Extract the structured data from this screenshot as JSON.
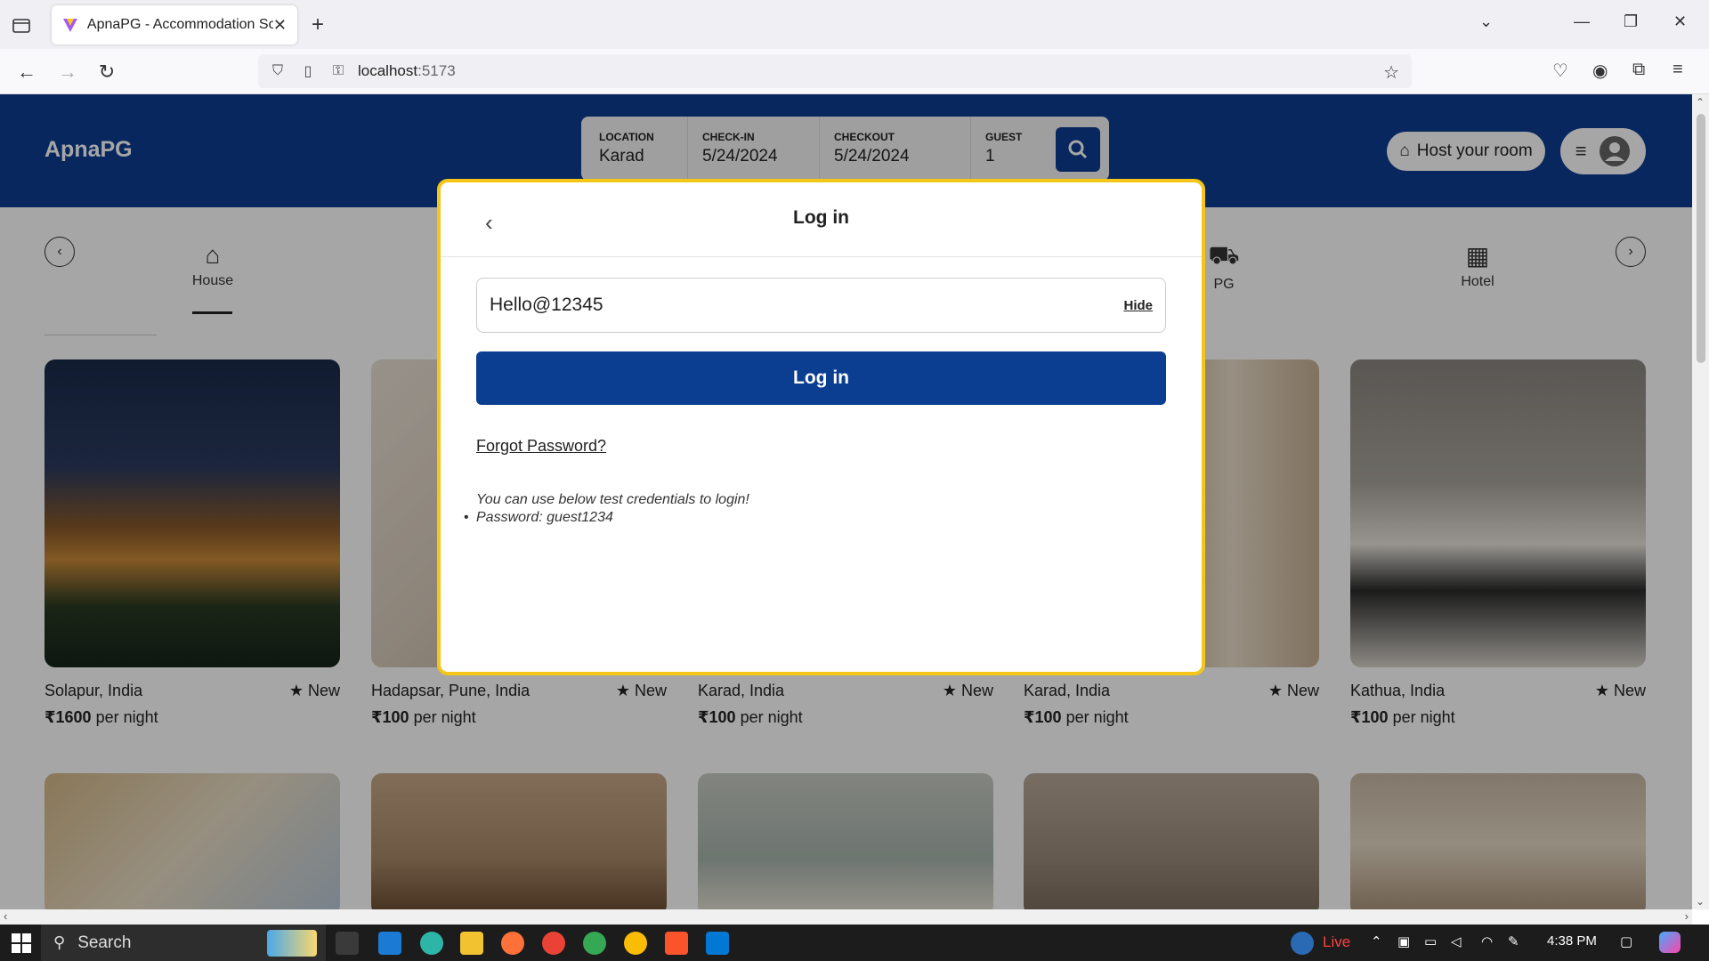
{
  "browser": {
    "tab_title": "ApnaPG - Accommodation Solu",
    "url_host": "localhost",
    "url_port": ":5173"
  },
  "header": {
    "logo": "ApnaPG",
    "search": {
      "location_label": "LOCATION",
      "location_value": "Karad",
      "checkin_label": "CHECK-IN",
      "checkin_value": "5/24/2024",
      "checkout_label": "CHECKOUT",
      "checkout_value": "5/24/2024",
      "guest_label": "GUEST",
      "guest_value": "1"
    },
    "host_label": "Host your room"
  },
  "categories": [
    {
      "label": "House",
      "icon": "house-icon"
    },
    {
      "label": "PG",
      "icon": "caravan-icon"
    },
    {
      "label": "Hotel",
      "icon": "hotel-icon"
    }
  ],
  "listings": [
    {
      "title": "Solapur, India",
      "rating": "New",
      "price": "₹1600",
      "unit": " per night"
    },
    {
      "title": "Hadapsar, Pune, India",
      "rating": "New",
      "price": "₹100",
      "unit": " per night"
    },
    {
      "title": "Karad, India",
      "rating": "New",
      "price": "₹100",
      "unit": " per night"
    },
    {
      "title": "Karad, India",
      "rating": "New",
      "price": "₹100",
      "unit": " per night"
    },
    {
      "title": "Kathua, India",
      "rating": "New",
      "price": "₹100",
      "unit": " per night"
    }
  ],
  "modal": {
    "title": "Log in",
    "password_value": "Hello@12345",
    "hide_label": "Hide",
    "login_label": "Log in",
    "forgot_label": "Forgot Password?",
    "hint": "You can use below test credentials to login!",
    "hint_password": "Password: guest1234"
  },
  "taskbar": {
    "search_label": "Search",
    "live_label": "Live",
    "time": "4:38 PM"
  },
  "colors": {
    "brand": "#0b3d91",
    "modal_border": "#f5c518"
  }
}
